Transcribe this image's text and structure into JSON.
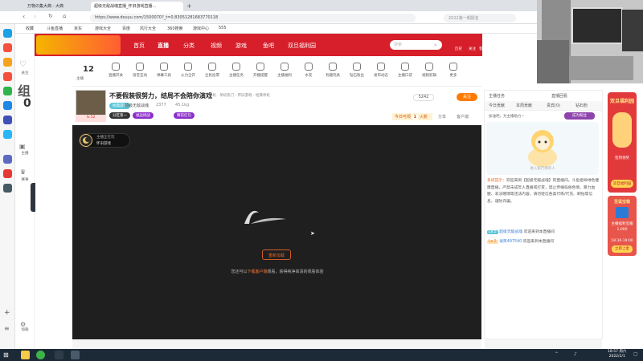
{
  "browser": {
    "tabs": [
      {
        "label": "万物の集大典 - 大典",
        "active": false
      },
      {
        "label": "超级无敌战魂直播_怀旧游戏直播...",
        "active": true
      }
    ],
    "url": "https://www.douyu.com/1500070?_t=0.83051281683770118",
    "search_placeholder": "2022第一期报名",
    "bookmarks": [
      "收藏",
      "斗鱼直播",
      "京东",
      "游戏大全",
      "百度",
      "风行大全",
      "360搜索",
      "游戏中心",
      "555"
    ]
  },
  "douyu": {
    "sidebar": {
      "follow_label": "关注",
      "zero": "0",
      "big_glyph": "组",
      "watch_label": "主播",
      "rank_label": "赛事",
      "settings_label": "加载"
    },
    "header": {
      "nav": [
        "首页",
        "直播",
        "分类",
        "视频",
        "游戏",
        "鱼吧",
        "双旦福利园"
      ],
      "search_placeholder": "搜索",
      "right_icons": [
        "历史",
        "关注",
        "客户端",
        "消息",
        "创作",
        "发布"
      ]
    },
    "toolbar": {
      "level": "12",
      "level_label": "主播",
      "tools": [
        "直播开关",
        "语音互动",
        "弹幕工具",
        "火力全开",
        "全民投票",
        "主播任务",
        "开播提醒",
        "主播福利",
        "水友",
        "有趣玩具",
        "钻石粉丝",
        "发布动态",
        "主播口袋",
        "视频剪辑",
        "更多"
      ]
    },
    "room": {
      "title": "不要假装很努力，结局不会陪你演戏",
      "category": "单机 · 单机热门 · 怀旧游戏 · 经典单机",
      "channel": "超级无敌战魂",
      "stats": [
        "2377",
        "45.1kg"
      ],
      "chips": [
        "分区第一",
        "福运挑战",
        "赛前红包"
      ],
      "tag_level": "lv.12",
      "tag_room": "经典游戏",
      "report": "举报",
      "share": "分享",
      "follower_count": "5242",
      "follow_btn": "关注",
      "ranking_label": "今日可领",
      "ranking_num": "1",
      "ranking_unit": "火箭",
      "gift_buttons": [
        "分享",
        "客户端"
      ]
    },
    "video": {
      "anchor_name": "主播正在玩",
      "anchor_game": "怀旧游戏",
      "retry_label": "重新加载",
      "message_pre": "您还可以",
      "message_link": "下载客户端",
      "message_post": "观看，获得纯净高清的观看体验"
    },
    "right_panel": {
      "tabs_top": [
        "主播任务",
        "直播回看"
      ],
      "tabs": [
        "今日贡献",
        "本周贡献",
        "贵宾(0)",
        "钻石粉"
      ],
      "rank_text": "加油吧，为主播助力~",
      "rank_button": "成为粉丝",
      "girl_caption": "进入排行榜的人",
      "sys_label": "系统提示：",
      "sys_message": "欢迎来到【超级无敌战魂】的直播间。斗鱼倡导绿色健康直播，严禁未成年人直播或打赏，禁止传播低俗色情、暴力血腥、非法赌博等违法内容，请勿轻信各类代练/代充、刷钻等信息，谨防诈骗。",
      "chat": [
        {
          "badge": "Lv.5",
          "user": "超级无敌战魂",
          "text": "欢迎来到本直播间"
        },
        {
          "badge": "Lv.2",
          "user": "很笑497540",
          "text": "欢迎来到本直播间"
        }
      ]
    },
    "ads": {
      "ad1_title": "双旦福利园",
      "ad1_sub": "签到领奖",
      "ad1_cta": "双旦福利园",
      "ad2_title": "圣诞宝箱",
      "ad2_text": "主播福利宝箱",
      "ad2_num": "1,000",
      "ad2_time": "18:30-19:00",
      "ad2_cta": "立即上麦"
    }
  },
  "taskbar": {
    "time": "18:57 周六",
    "date": "2022/1/1"
  },
  "colors": {
    "brand": "#d61f2a",
    "accent": "#ff7b00",
    "video_bg": "#1f1f1f"
  }
}
